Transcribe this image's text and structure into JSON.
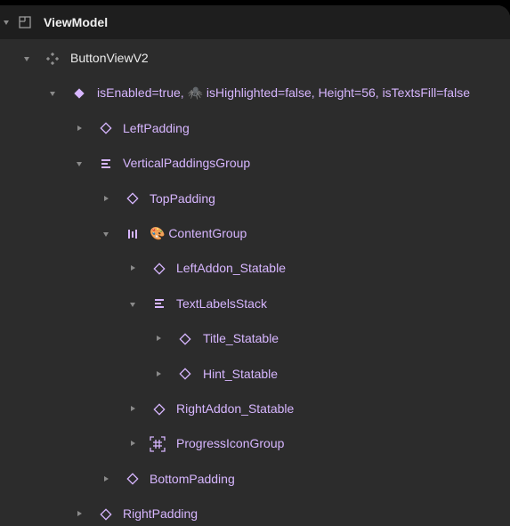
{
  "root": {
    "label": "ViewModel",
    "icon": "frame-icon"
  },
  "rows": [
    {
      "label": "ButtonViewV2",
      "icon": "component-icon",
      "caret": "down"
    },
    {
      "label": "isEnabled=true, 🕷️ isHighlighted=false, Height=56, isTextsFill=false",
      "icon": "instance-filled-icon",
      "caret": "down"
    },
    {
      "label": "LeftPadding",
      "icon": "instance-outline-icon",
      "caret": "right"
    },
    {
      "label": "VerticalPaddingsGroup",
      "icon": "vertical-stack-icon",
      "caret": "down"
    },
    {
      "label": "TopPadding",
      "icon": "instance-outline-icon",
      "caret": "right"
    },
    {
      "label": "🎨 ContentGroup",
      "icon": "horizontal-stack-icon",
      "caret": "down"
    },
    {
      "label": "LeftAddon_Statable",
      "icon": "instance-outline-icon",
      "caret": "right"
    },
    {
      "label": "TextLabelsStack",
      "icon": "vertical-stack-icon",
      "caret": "down"
    },
    {
      "label": "Title_Statable",
      "icon": "instance-outline-icon",
      "caret": "right"
    },
    {
      "label": "Hint_Statable",
      "icon": "instance-outline-icon",
      "caret": "right"
    },
    {
      "label": "RightAddon_Statable",
      "icon": "instance-outline-icon",
      "caret": "right"
    },
    {
      "label": "ProgressIconGroup",
      "icon": "grid-frame-icon",
      "caret": "right"
    },
    {
      "label": "BottomPadding",
      "icon": "instance-outline-icon",
      "caret": "right"
    },
    {
      "label": "RightPadding",
      "icon": "instance-outline-icon",
      "caret": "right"
    }
  ],
  "colors": {
    "accent": "#d7b6ff",
    "panel": "#2c2c2c",
    "header": "#1e1e1e"
  }
}
